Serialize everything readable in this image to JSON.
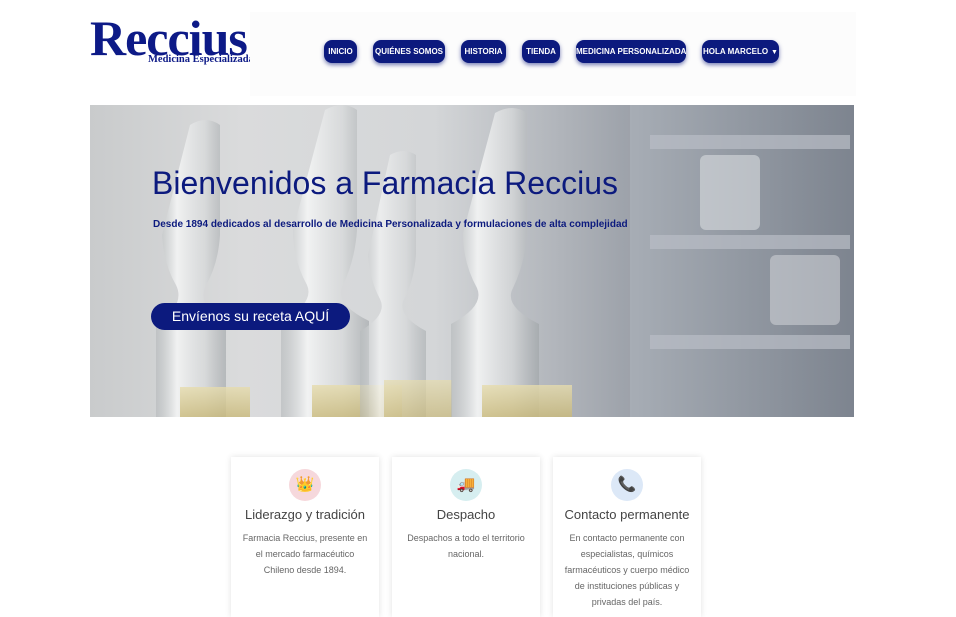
{
  "brand": {
    "name": "Reccius",
    "tagline": "Medicina Especializada",
    "color": "#0d1a87"
  },
  "nav": {
    "items": [
      {
        "label": "INICIO"
      },
      {
        "label": "QUIÉNES SOMOS"
      },
      {
        "label": "HISTORIA"
      },
      {
        "label": "TIENDA"
      },
      {
        "label": "MEDICINA PERSONALIZADA"
      },
      {
        "label": "HOLA MARCELO",
        "dropdown": true
      }
    ]
  },
  "hero": {
    "title": "Bienvenidos a Farmacia Reccius",
    "subtitle": "Desde 1894 dedicados al desarrollo de Medicina Personalizada y formulaciones de alta complejidad",
    "cta": "Envíenos su receta AQUÍ"
  },
  "features": [
    {
      "icon": "crown-icon",
      "title": "Liderazgo y tradición",
      "text": "Farmacia Reccius, presente en el mercado farmacéutico Chileno desde 1894."
    },
    {
      "icon": "delivery-truck-icon",
      "title": "Despacho",
      "text": "Despachos a todo el territorio nacional."
    },
    {
      "icon": "phone-icon",
      "title": "Contacto permanente",
      "text": "En contacto permanente con especialistas, químicos farmacéuticos y cuerpo médico de instituciones públicas y privadas del país."
    }
  ],
  "colors": {
    "accent": "#0c1a7e",
    "crown_bg": "#f6d8dc",
    "truck_bg": "#d6eef0",
    "phone_bg": "#dce8f7"
  }
}
